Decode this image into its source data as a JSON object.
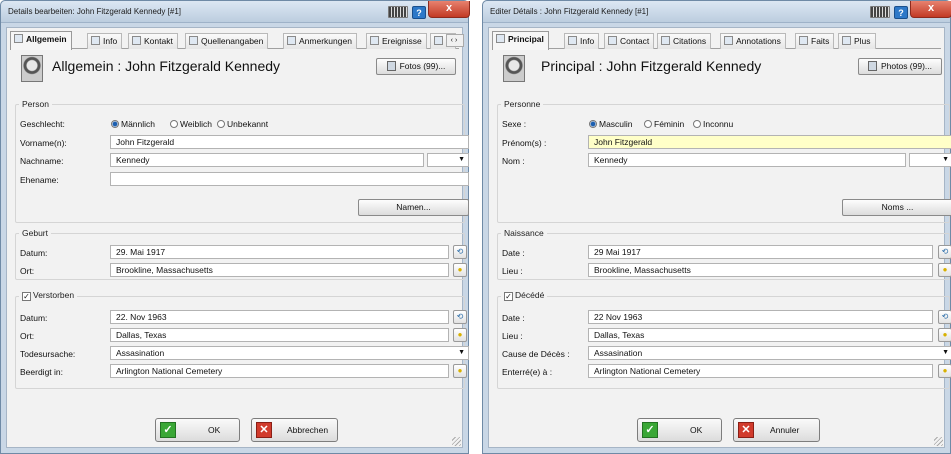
{
  "left": {
    "title": "Details bearbeiten: John Fitzgerald Kennedy [#1]",
    "close": "x",
    "help": "?",
    "tabs": [
      "Allgemein",
      "Info",
      "Kontakt",
      "Quellenangaben",
      "Anmerkungen",
      "Ereignisse",
      "O"
    ],
    "heading": "Allgemein : John Fitzgerald Kennedy",
    "media_button": "Fotos (99)...",
    "person_legend": "Person",
    "gender_label": "Geschlecht:",
    "gender_options": [
      "Männlich",
      "Weiblich",
      "Unbekannt"
    ],
    "firstname_label": "Vorname(n):",
    "firstname_value": "John Fitzgerald",
    "lastname_label": "Nachname:",
    "lastname_value": "Kennedy",
    "marriedname_label": "Ehename:",
    "marriedname_value": "",
    "names_button": "Namen...",
    "birth_legend": "Geburt",
    "birth_date_label": "Datum:",
    "birth_date_value": "29. Mai 1917",
    "birth_place_label": "Ort:",
    "birth_place_value": "Brookline, Massachusetts",
    "deceased_label": "Verstorben",
    "death_date_label": "Datum:",
    "death_date_value": "22. Nov 1963",
    "death_place_label": "Ort:",
    "death_place_value": "Dallas, Texas",
    "cause_label": "Todesursache:",
    "cause_value": "Assasination",
    "buried_label": "Beerdigt in:",
    "buried_value": "Arlington National Cemetery",
    "ok": "OK",
    "cancel": "Abbrechen"
  },
  "right": {
    "title": "Editer Détails : John Fitzgerald Kennedy [#1]",
    "close": "x",
    "help": "?",
    "tabs": [
      "Principal",
      "Info",
      "Contact",
      "Citations",
      "Annotations",
      "Faits",
      "Plus"
    ],
    "heading": "Principal : John Fitzgerald Kennedy",
    "media_button": "Photos (99)...",
    "person_legend": "Personne",
    "gender_label": "Sexe :",
    "gender_options": [
      "Masculin",
      "Féminin",
      "Inconnu"
    ],
    "firstname_label": "Prénom(s) :",
    "firstname_value": "John Fitzgerald",
    "lastname_label": "Nom :",
    "lastname_value": "Kennedy",
    "names_button": "Noms ...",
    "birth_legend": "Naissance",
    "birth_date_label": "Date :",
    "birth_date_value": "29 Mai 1917",
    "birth_place_label": "Lieu :",
    "birth_place_value": "Brookline, Massachusetts",
    "deceased_label": "Décédé",
    "death_date_label": "Date :",
    "death_date_value": "22 Nov 1963",
    "death_place_label": "Lieu :",
    "death_place_value": "Dallas, Texas",
    "cause_label": "Cause de Décès :",
    "cause_value": "Assasination",
    "buried_label": "Enterré(e) à :",
    "buried_value": "Arlington National Cemetery",
    "ok": "OK",
    "cancel": "Annuler"
  }
}
